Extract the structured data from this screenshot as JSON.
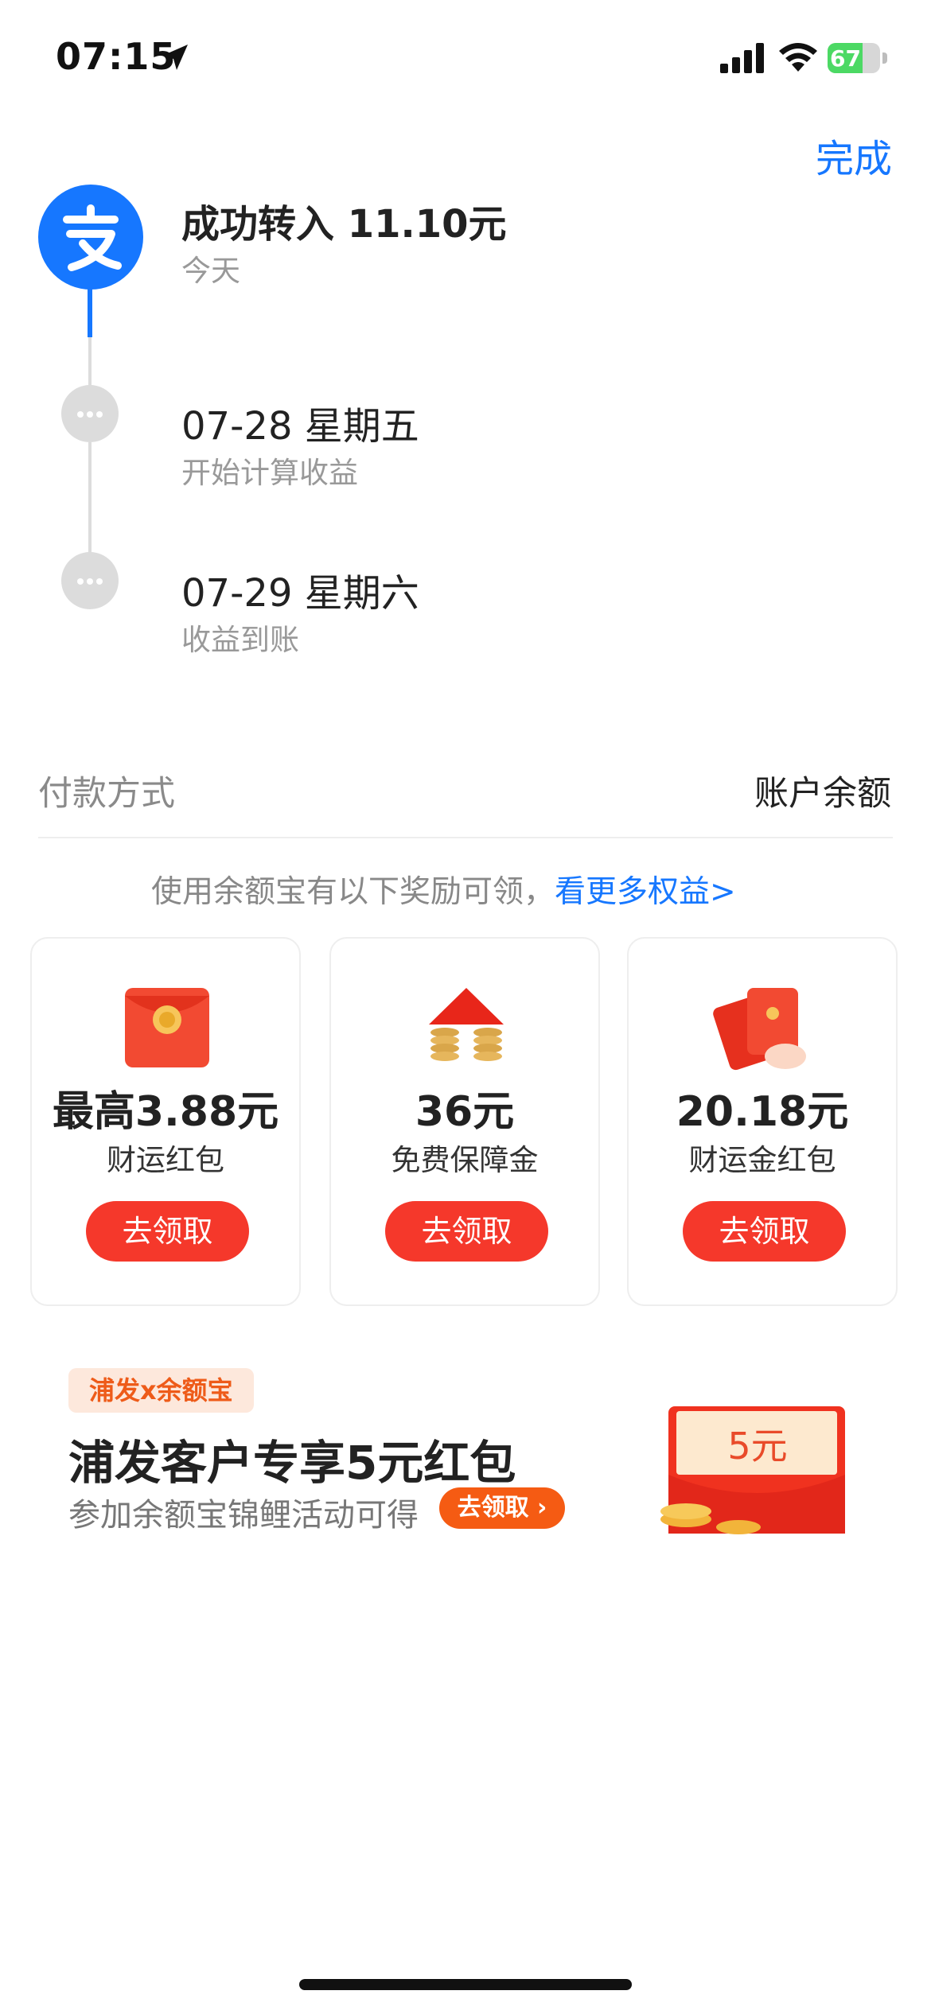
{
  "status_bar": {
    "time": "07:15",
    "battery_level": "67",
    "battery_color": "#4cd964"
  },
  "header": {
    "done_label": "完成"
  },
  "timeline": {
    "steps": [
      {
        "title": "成功转入 11.10元",
        "subtitle": "今天",
        "icon": "alipay-logo"
      },
      {
        "title": "07-28 星期五",
        "subtitle": "开始计算收益",
        "icon": "ellipsis-dot"
      },
      {
        "title": "07-29 星期六",
        "subtitle": "收益到账",
        "icon": "ellipsis-dot"
      }
    ]
  },
  "payment": {
    "label": "付款方式",
    "value": "账户余额"
  },
  "rewards": {
    "note": "使用余额宝有以下奖励可领，",
    "more_link": "看更多权益>",
    "cards": [
      {
        "amount": "最高3.88元",
        "label": "财运红包",
        "button": "去领取",
        "icon": "red-envelope-icon"
      },
      {
        "amount": "36元",
        "label": "免费保障金",
        "button": "去领取",
        "icon": "house-coins-icon"
      },
      {
        "amount": "20.18元",
        "label": "财运金红包",
        "button": "去领取",
        "icon": "hand-red-envelope-icon"
      }
    ]
  },
  "promo": {
    "tag": "浦发x余额宝",
    "title": "浦发客户专享5元红包",
    "subtitle": "参加余额宝锦鲤活动可得",
    "button": "去领取",
    "envelope_value": "5元"
  },
  "colors": {
    "accent": "#1677ff",
    "button_red": "#f5382b",
    "promo_orange": "#f55b13"
  }
}
